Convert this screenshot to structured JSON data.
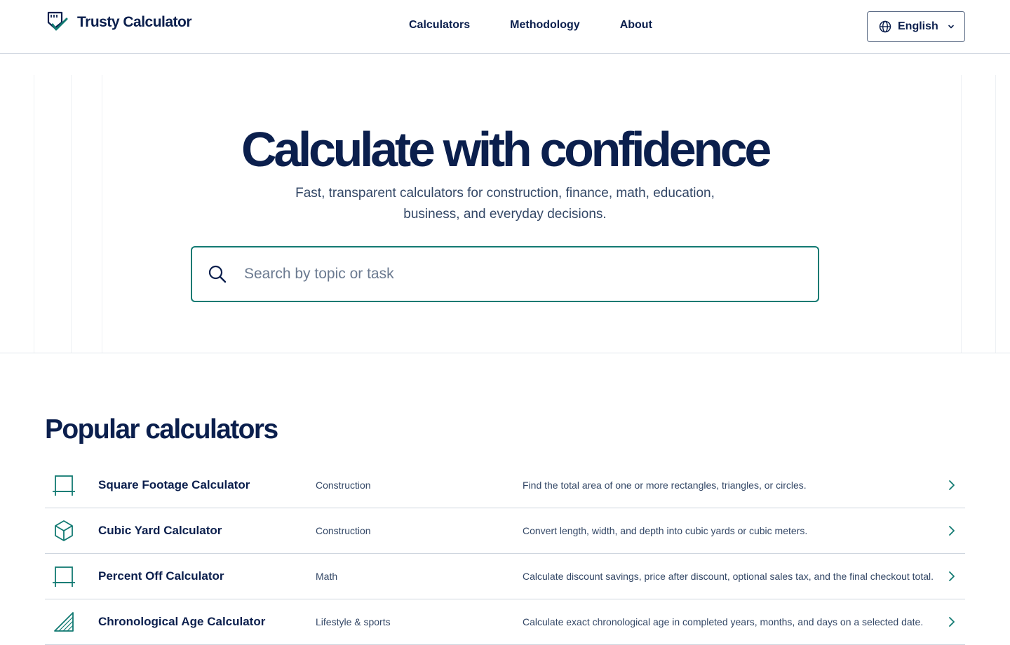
{
  "header": {
    "brand": "Trusty Calculator",
    "nav": [
      "Calculators",
      "Methodology",
      "About"
    ],
    "language": "English"
  },
  "hero": {
    "title": "Calculate with confidence",
    "subtitle": "Fast, transparent calculators for construction, finance, math, education, business, and everyday decisions.",
    "search_placeholder": "Search by topic or task"
  },
  "popular": {
    "title": "Popular calculators",
    "items": [
      {
        "name": "Square Footage Calculator",
        "category": "Construction",
        "description": "Find the total area of one or more rectangles, triangles, or circles.",
        "icon": "square-frame-icon"
      },
      {
        "name": "Cubic Yard Calculator",
        "category": "Construction",
        "description": "Convert length, width, and depth into cubic yards or cubic meters.",
        "icon": "cube-icon"
      },
      {
        "name": "Percent Off Calculator",
        "category": "Math",
        "description": "Calculate discount savings, price after discount, optional sales tax, and the final checkout total.",
        "icon": "square-frame-icon"
      },
      {
        "name": "Chronological Age Calculator",
        "category": "Lifestyle & sports",
        "description": "Calculate exact chronological age in completed years, months, and days on a selected date.",
        "icon": "triangle-ruler-icon"
      }
    ]
  },
  "colors": {
    "navy": "#0b1f4d",
    "teal": "#127a72",
    "text_muted": "#334766"
  }
}
